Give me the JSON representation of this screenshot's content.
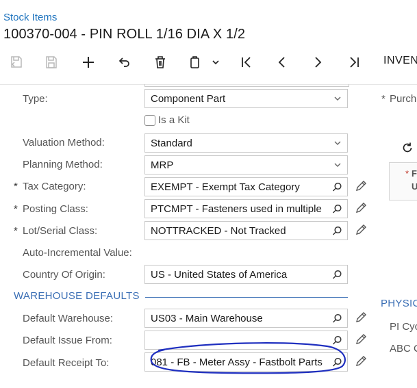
{
  "breadcrumb": "Stock Items",
  "title": "100370-004 - PIN ROLL 1/16 DIA X 1/2",
  "toolbar": {
    "icons": [
      "save-cancel-icon",
      "save-icon",
      "add-icon",
      "undo-icon",
      "delete-icon",
      "copy-paste-icon",
      "first-record-icon",
      "previous-record-icon",
      "next-record-icon",
      "last-record-icon"
    ],
    "tab_label": "INVEN"
  },
  "form": {
    "type": {
      "label": "Type:",
      "value": "Component Part"
    },
    "is_kit": {
      "label": "Is a Kit",
      "checked": false
    },
    "valuation_method": {
      "label": "Valuation Method:",
      "value": "Standard"
    },
    "planning_method": {
      "label": "Planning Method:",
      "value": "MRP"
    },
    "tax_category": {
      "label": "Tax Category:",
      "value": "EXEMPT - Exempt Tax Category",
      "required": "*"
    },
    "posting_class": {
      "label": "Posting Class:",
      "value": "PTCMPT - Fasteners used in multiple",
      "required": "*"
    },
    "lot_serial_class": {
      "label": "Lot/Serial Class:",
      "value": "NOTTRACKED - Not Tracked",
      "required": "*"
    },
    "auto_incremental": {
      "label": "Auto-Incremental Value:"
    },
    "country_of_origin": {
      "label": "Country Of Origin:",
      "value": "US - United States of America"
    }
  },
  "warehouse_defaults": {
    "title": "WAREHOUSE DEFAULTS",
    "default_warehouse": {
      "label": "Default Warehouse:",
      "value": "US03 - Main Warehouse"
    },
    "default_issue_from": {
      "label": "Default Issue From:",
      "value": ""
    },
    "default_receipt_to": {
      "label": "Default Receipt To:",
      "value": "081 - FB - Meter Assy - Fastbolt Parts"
    }
  },
  "right_panel": {
    "purchase_label": "Purch",
    "purchase_required": "*",
    "box_required": "*",
    "box_line1": "F",
    "box_line2": "U",
    "section_title": "PHYSIC",
    "pi_cycle_label": "PI Cyc",
    "abc_label": "ABC C"
  },
  "colors": {
    "accent": "#1e73be",
    "section": "#3b6fb5",
    "annotation": "#1f2fbf"
  }
}
